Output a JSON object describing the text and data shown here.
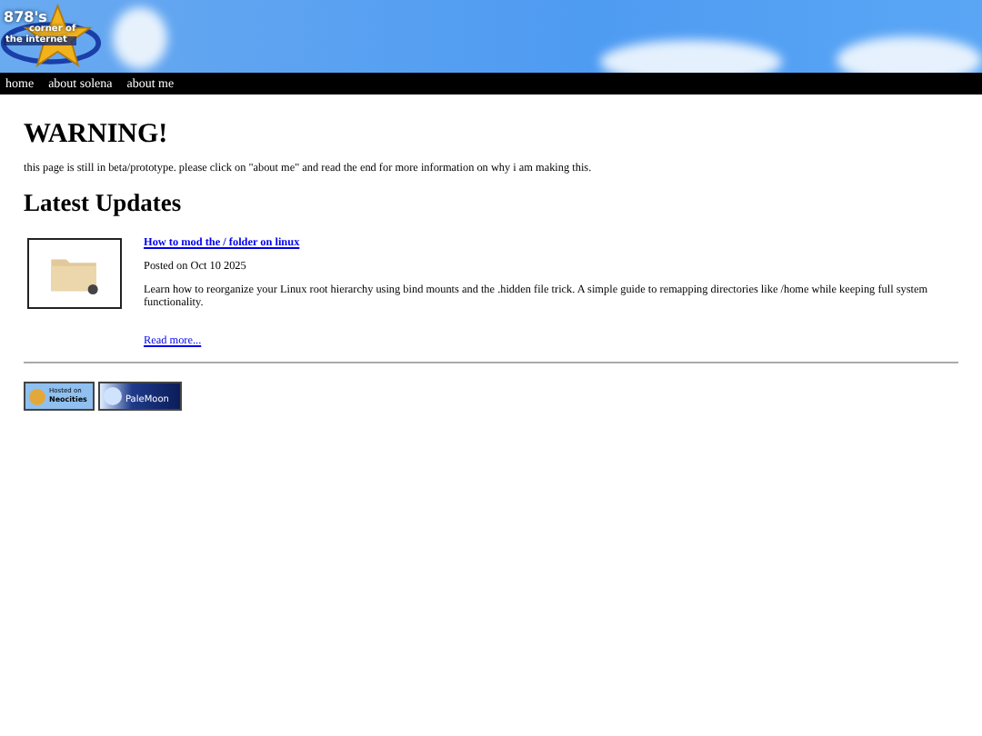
{
  "header": {
    "logo": {
      "line_1": "878's",
      "line_2": "corner of",
      "line_3": "the internet"
    }
  },
  "nav": [
    {
      "label": "home"
    },
    {
      "label": "about solena"
    },
    {
      "label": "about me"
    }
  ],
  "warning": {
    "title": "WARNING!",
    "text": "this page is still in beta/prototype. please click on \"about me\" and read the end for more information on why i am making this."
  },
  "updates": {
    "title": "Latest Updates",
    "posts": [
      {
        "title": "How to mod the / folder on linux",
        "date": "Posted on Oct 10 2025",
        "summary": "Learn how to reorganize your Linux root hierarchy using bind mounts and the .hidden file trick. A simple guide to remapping directories like /home while keeping full system functionality.",
        "link": "Read more..."
      }
    ]
  },
  "badges": [
    {
      "kind": "neocities",
      "line_1": "Hosted on",
      "line_2": "Neocities"
    },
    {
      "kind": "palemoon",
      "line_1": "PaleMoon"
    }
  ]
}
